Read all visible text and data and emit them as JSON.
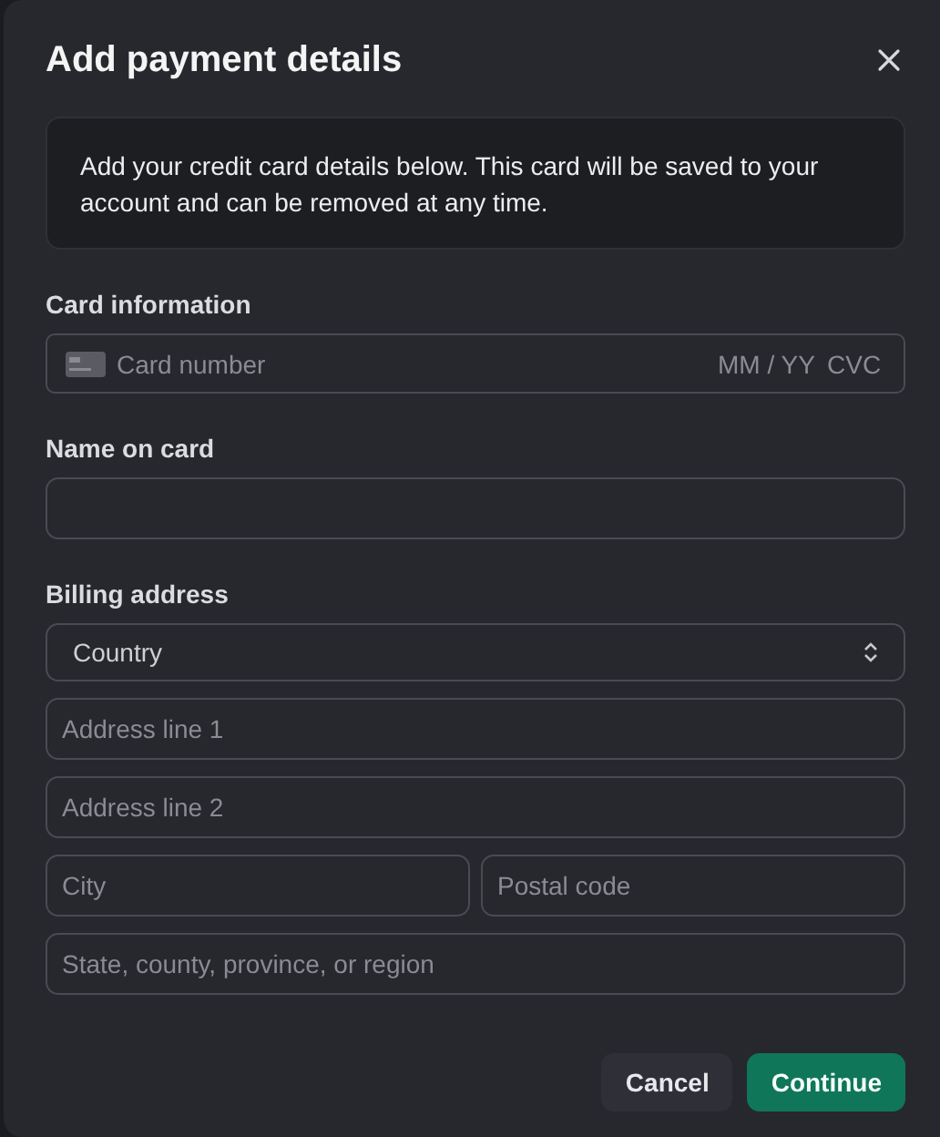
{
  "dialog": {
    "title": "Add payment details"
  },
  "notice": "Add your credit card details below. This card will be saved to your account and can be removed at any time.",
  "card_information": {
    "label": "Card information",
    "card_number_placeholder": "Card number",
    "expiry_placeholder": "MM / YY",
    "cvc_placeholder": "CVC"
  },
  "name_on_card": {
    "label": "Name on card"
  },
  "billing_address": {
    "label": "Billing address",
    "country": "Country",
    "rows": [
      [
        {
          "placeholder": "Address line 1"
        }
      ],
      [
        {
          "placeholder": "Address line 2"
        }
      ],
      [
        {
          "placeholder": "City"
        },
        {
          "placeholder": "Postal code"
        }
      ],
      [
        {
          "placeholder": "State, county, province, or region"
        }
      ]
    ]
  },
  "buttons": [
    {
      "label": "Cancel",
      "kind": "secondary"
    },
    {
      "label": "Continue",
      "kind": "primary"
    }
  ]
}
